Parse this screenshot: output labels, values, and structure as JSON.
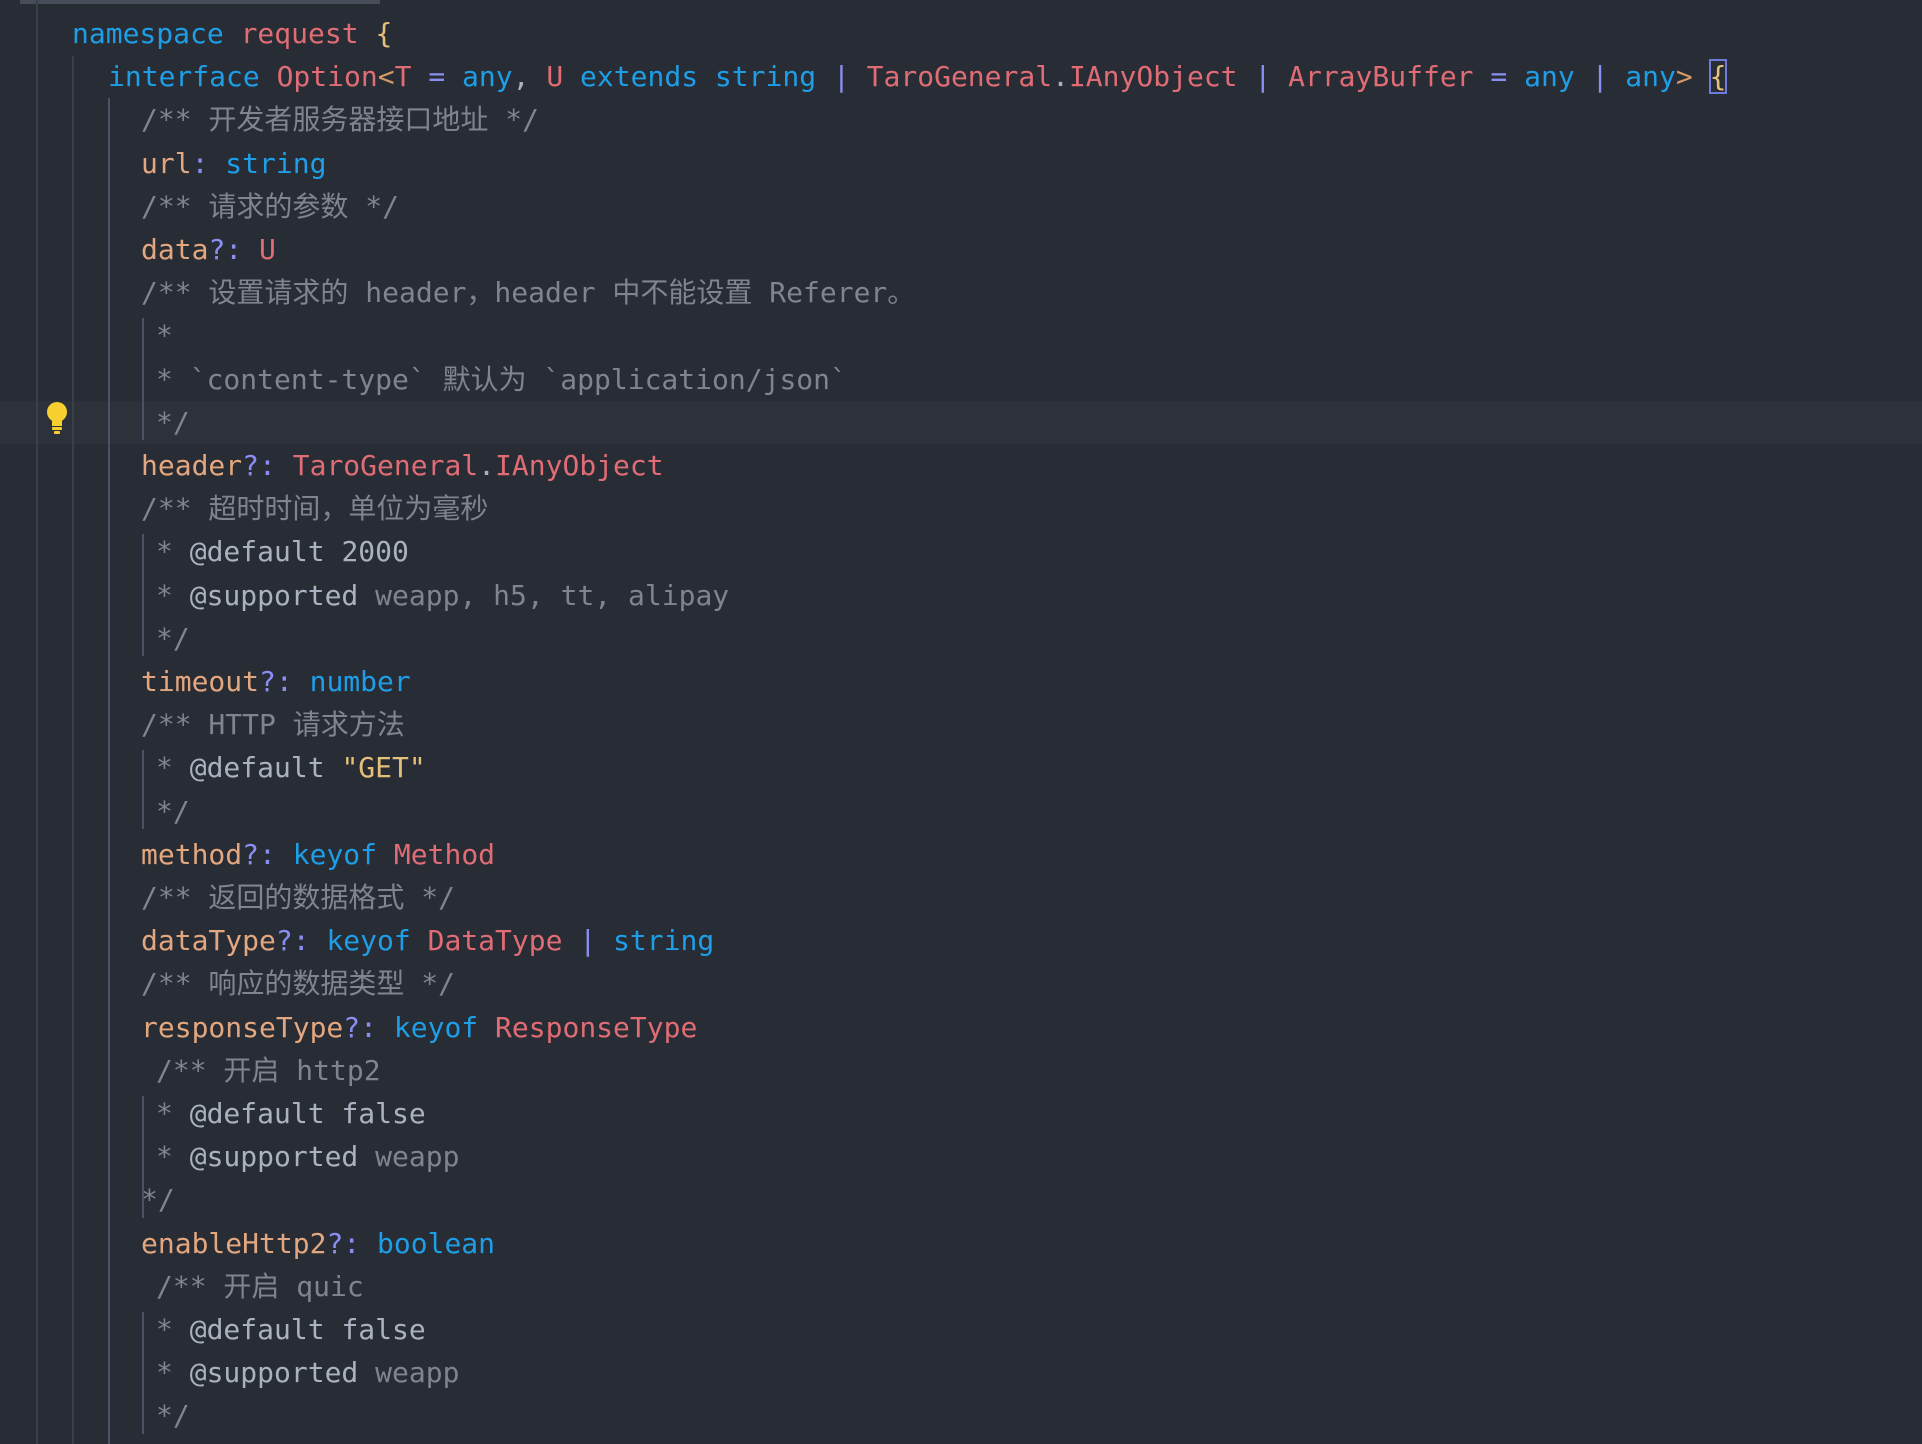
{
  "editor": {
    "colors": {
      "background": "#282c34",
      "current_line": "#2c313a",
      "keyword": "#1e9ee6",
      "type": "#e06c75",
      "operator": "#8a8ef3",
      "property": "#e3a77f",
      "comment": "#7f848e",
      "string": "#e5c07b",
      "lightbulb": "#f7d02f"
    },
    "icons": [
      "lightbulb-icon"
    ],
    "lines": [
      {
        "id": "l1",
        "tokens": [
          [
            "kw",
            "namespace"
          ],
          [
            "pl",
            " "
          ],
          [
            "ns",
            "request"
          ],
          [
            "pl",
            " "
          ],
          [
            "br",
            "{"
          ]
        ]
      },
      {
        "id": "l2",
        "tokens": [
          [
            "kw",
            "interface"
          ],
          [
            "pl",
            " "
          ],
          [
            "tp",
            "Option"
          ],
          [
            "br2",
            "<"
          ],
          [
            "tp",
            "T"
          ],
          [
            "pl",
            " "
          ],
          [
            "op",
            "="
          ],
          [
            "pl",
            " "
          ],
          [
            "kw",
            "any"
          ],
          [
            "pl",
            ", "
          ],
          [
            "tp",
            "U"
          ],
          [
            "pl",
            " "
          ],
          [
            "kw",
            "extends"
          ],
          [
            "pl",
            " "
          ],
          [
            "kw",
            "string"
          ],
          [
            "pl",
            " "
          ],
          [
            "op",
            "|"
          ],
          [
            "pl",
            " "
          ],
          [
            "ns",
            "TaroGeneral"
          ],
          [
            "pl",
            "."
          ],
          [
            "tp",
            "IAnyObject"
          ],
          [
            "pl",
            " "
          ],
          [
            "op",
            "|"
          ],
          [
            "pl",
            " "
          ],
          [
            "tp",
            "ArrayBuffer"
          ],
          [
            "pl",
            " "
          ],
          [
            "op",
            "="
          ],
          [
            "pl",
            " "
          ],
          [
            "kw",
            "any"
          ],
          [
            "pl",
            " "
          ],
          [
            "op",
            "|"
          ],
          [
            "pl",
            " "
          ],
          [
            "kw",
            "any"
          ],
          [
            "br2",
            ">"
          ],
          [
            "pl",
            " "
          ],
          [
            "brbox",
            "{"
          ]
        ]
      },
      {
        "id": "l3",
        "tokens": [
          [
            "cm",
            "/** 开发者服务器接口地址 */"
          ]
        ]
      },
      {
        "id": "l4",
        "tokens": [
          [
            "prop",
            "url"
          ],
          [
            "op",
            ":"
          ],
          [
            "pl",
            " "
          ],
          [
            "kw",
            "string"
          ]
        ]
      },
      {
        "id": "l5",
        "tokens": [
          [
            "cm",
            "/** 请求的参数 */"
          ]
        ]
      },
      {
        "id": "l6",
        "tokens": [
          [
            "prop",
            "data"
          ],
          [
            "op",
            "?:"
          ],
          [
            "pl",
            " "
          ],
          [
            "tp",
            "U"
          ]
        ]
      },
      {
        "id": "l7",
        "tokens": [
          [
            "cm",
            "/** 设置请求的 header，header 中不能设置 Referer。"
          ]
        ]
      },
      {
        "id": "l8",
        "tokens": [
          [
            "cm",
            "*"
          ]
        ]
      },
      {
        "id": "l9",
        "tokens": [
          [
            "cm",
            "* `content-type` 默认为 `application/json`"
          ]
        ]
      },
      {
        "id": "l10",
        "tokens": [
          [
            "cm",
            "*/"
          ]
        ]
      },
      {
        "id": "l11",
        "tokens": [
          [
            "prop",
            "header"
          ],
          [
            "op",
            "?:"
          ],
          [
            "pl",
            " "
          ],
          [
            "ns",
            "TaroGeneral"
          ],
          [
            "pl",
            "."
          ],
          [
            "tp",
            "IAnyObject"
          ]
        ]
      },
      {
        "id": "l12",
        "tokens": [
          [
            "cm",
            "/** 超时时间，单位为毫秒"
          ]
        ]
      },
      {
        "id": "l13",
        "tokens": [
          [
            "cm",
            "* "
          ],
          [
            "tag",
            "@default"
          ],
          [
            "pl",
            " "
          ],
          [
            "tag",
            "2000"
          ]
        ]
      },
      {
        "id": "l14",
        "tokens": [
          [
            "cm",
            "* "
          ],
          [
            "tag",
            "@supported"
          ],
          [
            "cm",
            " weapp, h5, tt, alipay"
          ]
        ]
      },
      {
        "id": "l15",
        "tokens": [
          [
            "cm",
            "*/"
          ]
        ]
      },
      {
        "id": "l16",
        "tokens": [
          [
            "prop",
            "timeout"
          ],
          [
            "op",
            "?:"
          ],
          [
            "pl",
            " "
          ],
          [
            "kw",
            "number"
          ]
        ]
      },
      {
        "id": "l17",
        "tokens": [
          [
            "cm",
            "/** HTTP 请求方法"
          ]
        ]
      },
      {
        "id": "l18",
        "tokens": [
          [
            "cm",
            "* "
          ],
          [
            "tag",
            "@default"
          ],
          [
            "pl",
            " "
          ],
          [
            "str",
            "\"GET\""
          ]
        ]
      },
      {
        "id": "l19",
        "tokens": [
          [
            "cm",
            "*/"
          ]
        ]
      },
      {
        "id": "l20",
        "tokens": [
          [
            "prop",
            "method"
          ],
          [
            "op",
            "?:"
          ],
          [
            "pl",
            " "
          ],
          [
            "kw",
            "keyof"
          ],
          [
            "pl",
            " "
          ],
          [
            "tp",
            "Method"
          ]
        ]
      },
      {
        "id": "l21",
        "tokens": [
          [
            "cm",
            "/** 返回的数据格式 */"
          ]
        ]
      },
      {
        "id": "l22",
        "tokens": [
          [
            "prop",
            "dataType"
          ],
          [
            "op",
            "?:"
          ],
          [
            "pl",
            " "
          ],
          [
            "kw",
            "keyof"
          ],
          [
            "pl",
            " "
          ],
          [
            "tp",
            "DataType"
          ],
          [
            "pl",
            " "
          ],
          [
            "op",
            "|"
          ],
          [
            "pl",
            " "
          ],
          [
            "kw",
            "string"
          ]
        ]
      },
      {
        "id": "l23",
        "tokens": [
          [
            "cm",
            "/** 响应的数据类型 */"
          ]
        ]
      },
      {
        "id": "l24",
        "tokens": [
          [
            "prop",
            "responseType"
          ],
          [
            "op",
            "?:"
          ],
          [
            "pl",
            " "
          ],
          [
            "kw",
            "keyof"
          ],
          [
            "pl",
            " "
          ],
          [
            "tp",
            "ResponseType"
          ]
        ]
      },
      {
        "id": "l25",
        "tokens": [
          [
            "cm",
            "/** 开启 http2"
          ]
        ]
      },
      {
        "id": "l26",
        "tokens": [
          [
            "cm",
            "* "
          ],
          [
            "tag",
            "@default"
          ],
          [
            "pl",
            " "
          ],
          [
            "tag",
            "false"
          ]
        ]
      },
      {
        "id": "l27",
        "tokens": [
          [
            "cm",
            "* "
          ],
          [
            "tag",
            "@supported"
          ],
          [
            "cm",
            " weapp"
          ]
        ]
      },
      {
        "id": "l28",
        "tokens": [
          [
            "cm",
            "*/"
          ]
        ]
      },
      {
        "id": "l29",
        "tokens": [
          [
            "prop",
            "enableHttp2"
          ],
          [
            "op",
            "?:"
          ],
          [
            "pl",
            " "
          ],
          [
            "kw",
            "boolean"
          ]
        ]
      },
      {
        "id": "l30",
        "tokens": [
          [
            "cm",
            "/** 开启 quic"
          ]
        ]
      },
      {
        "id": "l31",
        "tokens": [
          [
            "cm",
            "* "
          ],
          [
            "tag",
            "@default"
          ],
          [
            "pl",
            " "
          ],
          [
            "tag",
            "false"
          ]
        ]
      },
      {
        "id": "l32",
        "tokens": [
          [
            "cm",
            "* "
          ],
          [
            "tag",
            "@supported"
          ],
          [
            "cm",
            " weapp"
          ]
        ]
      },
      {
        "id": "l33",
        "tokens": [
          [
            "cm",
            "*/"
          ]
        ]
      }
    ]
  }
}
